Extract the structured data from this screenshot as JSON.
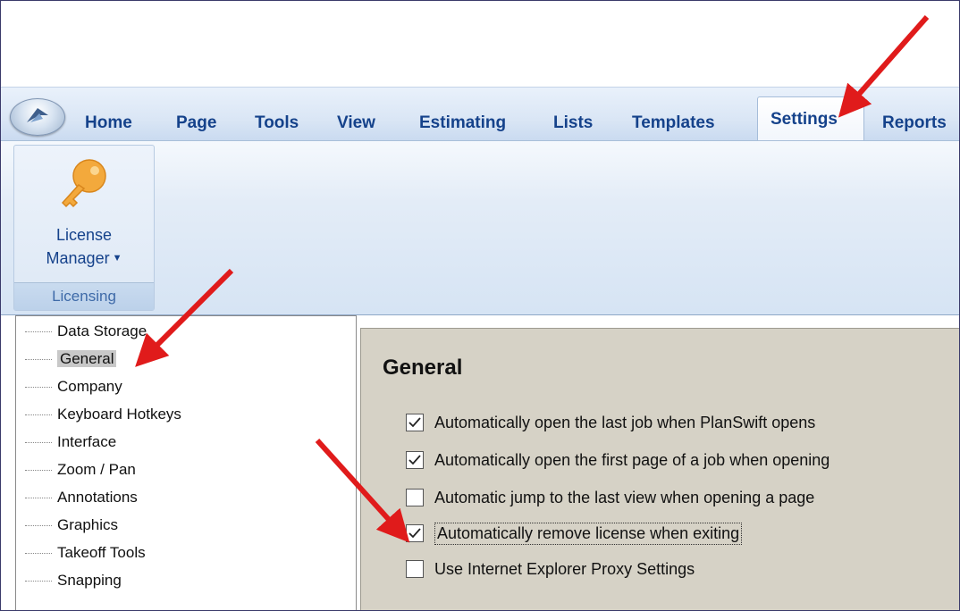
{
  "tabs": [
    "Home",
    "Page",
    "Tools",
    "View",
    "Estimating",
    "Lists",
    "Templates"
  ],
  "active_tab": "Settings",
  "overflow_tab": "Reports",
  "ribbon": {
    "button_line1": "License",
    "button_line2": "Manager",
    "group_label": "Licensing",
    "key_icon": "key-icon"
  },
  "tree": {
    "items": [
      "Data Storage",
      "General",
      "Company",
      "Keyboard Hotkeys",
      "Interface",
      "Zoom / Pan",
      "Annotations",
      "Graphics",
      "Takeoff Tools",
      "Snapping"
    ],
    "selected": "General"
  },
  "settings": {
    "title": "General",
    "options": [
      {
        "label": "Automatically open the last job when PlanSwift opens",
        "checked": true
      },
      {
        "label": "Automatically open the first page of a job when opening",
        "checked": true
      },
      {
        "label": "Automatic jump to the last view when opening a page",
        "checked": false
      },
      {
        "label": "Automatically remove license when exiting",
        "checked": true
      },
      {
        "label": "Use Internet Explorer Proxy Settings",
        "checked": false
      }
    ]
  },
  "colors": {
    "tab_text": "#15428b",
    "annotation_arrow": "#e01b1b",
    "settings_bg": "#d6d2c6"
  }
}
